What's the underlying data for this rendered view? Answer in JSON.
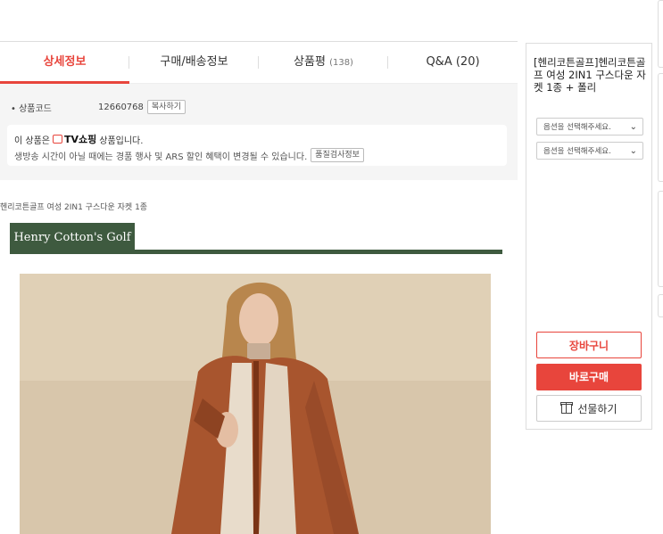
{
  "tabs": [
    {
      "label": "상세정보",
      "count": ""
    },
    {
      "label": "구매/배송정보",
      "count": ""
    },
    {
      "label": "상품평",
      "count": "(138)"
    },
    {
      "label": "Q&A (20)",
      "count": ""
    }
  ],
  "product_info": {
    "code_label": "상품코드",
    "code_value": "12660768",
    "copy_button": "복사하기",
    "tv_notice_prefix": "이 상품은",
    "tv_brand": "TV쇼핑",
    "tv_notice_suffix": "상품입니다.",
    "broadcast_notice": "생방송 시간이 아닐 때에는 경품 행사 및 ARS 할인 혜택이 변경될 수 있습니다.",
    "quality_button": "품질검사정보"
  },
  "breadcrumb": "헨리코튼골프 여성 2IN1 구스다운 자켓 1종",
  "brand_banner": "Henry Cotton's Golf",
  "panel": {
    "product_name": "[헨리코튼골프]헨리코튼골프 여성 2IN1 구스다운 자켓 1종 + 폴리",
    "option1": "옵션을 선택해주세요.",
    "option2": "옵션을 선택해주세요.",
    "cart_button": "장바구니",
    "buy_button": "바로구매",
    "gift_button": "선물하기"
  },
  "colors": {
    "accent": "#e8453c",
    "brand_green": "#3e5a3f"
  },
  "icons": [
    "tv-shopping-icon",
    "chevron-down-icon",
    "gift-icon"
  ]
}
